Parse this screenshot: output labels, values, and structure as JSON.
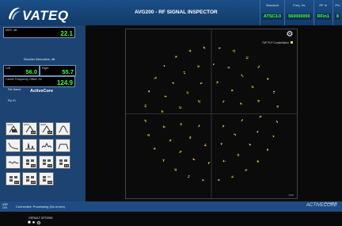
{
  "header": {
    "logo_text": "VATEQ",
    "title": "AVG200 - RF SIGNAL INSPECTOR",
    "stats": [
      {
        "label": "Standard",
        "value": "ATSC3.0"
      },
      {
        "label": "Freq. Hz",
        "value": "560000000"
      },
      {
        "label": "RF In",
        "value": "RFin1"
      },
      {
        "label": "Pro",
        "value": "8"
      }
    ]
  },
  "sidebar": {
    "mer": {
      "label": "MER, dB",
      "value": "22.1"
    },
    "shoulder_header": "Shoulder Attenuation, dB",
    "left": {
      "label": "Left",
      "value": "56.0"
    },
    "right": {
      "label": "Right",
      "value": "55.7"
    },
    "carrier": {
      "label": "Carrier Frequency Offset, Hz",
      "value": "124.9"
    },
    "file_name_label": "File Name",
    "file_name": "ActiveCore",
    "plp_label": "Plp ID",
    "tools": [
      {
        "name": "tool-qam-1",
        "tag": "QAM",
        "badge": ""
      },
      {
        "name": "tool-qam-2",
        "tag": "QAM",
        "badge": "1/4"
      },
      {
        "name": "tool-qam-3",
        "tag": "QAM",
        "badge": "1/4"
      },
      {
        "name": "tool-spectrum",
        "tag": "",
        "badge": ""
      },
      {
        "name": "tool-decay",
        "tag": "",
        "badge": ""
      },
      {
        "name": "tool-impulse",
        "tag": "",
        "badge": ""
      },
      {
        "name": "tool-bins",
        "tag": "",
        "badge": ""
      },
      {
        "name": "tool-shape",
        "tag": "",
        "badge": ""
      },
      {
        "name": "tool-wave",
        "tag": "",
        "badge": ""
      },
      {
        "name": "tool-grid-a",
        "tag": "",
        "badge": "1/4"
      },
      {
        "name": "tool-grid-b",
        "tag": "",
        "badge": "1/4"
      },
      {
        "name": "tool-grid-c",
        "tag": "",
        "badge": "1/4"
      },
      {
        "name": "tool-grid-d",
        "tag": "",
        "badge": "1/4"
      },
      {
        "name": "tool-grid-e",
        "tag": "",
        "badge": "1/4"
      },
      {
        "name": "tool-grid-f",
        "tag": "",
        "badge": "1/4"
      }
    ],
    "options_caption": "DEFAULT OPTIONS"
  },
  "plot": {
    "legend": "TAP PLP Constellation",
    "corner_label": "DSC",
    "accent": "#e6d24a"
  },
  "status": {
    "side_text": "ASR\nODI",
    "text": "Connected: Processing (No errors)",
    "brand": "ACTIVECORE",
    "brand_small": "Powered by"
  }
}
